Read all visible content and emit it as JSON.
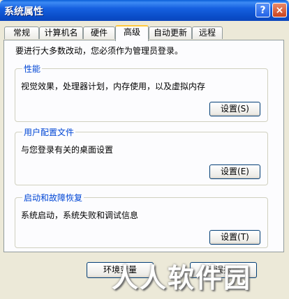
{
  "window": {
    "title": "系统属性",
    "help_glyph": "?",
    "close_glyph": "×"
  },
  "tabs": [
    {
      "label": "常规"
    },
    {
      "label": "计算机名"
    },
    {
      "label": "硬件"
    },
    {
      "label": "高级",
      "active": true
    },
    {
      "label": "自动更新"
    },
    {
      "label": "远程"
    }
  ],
  "intro_text": "要进行大多数改动，您必须作为管理员登录。",
  "groups": {
    "performance": {
      "title": "性能",
      "description": "视觉效果，处理器计划，内存使用，以及虚拟内存",
      "button": "设置(S)"
    },
    "user_profiles": {
      "title": "用户配置文件",
      "description": "与您登录有关的桌面设置",
      "button": "设置(E)"
    },
    "startup_recovery": {
      "title": "启动和故障恢复",
      "description": "系统启动，系统失败和调试信息",
      "button": "设置(T)"
    }
  },
  "bottom_buttons": {
    "env_vars": "环境变量",
    "error_report": "错误报告"
  },
  "watermark": "人人软件园"
}
